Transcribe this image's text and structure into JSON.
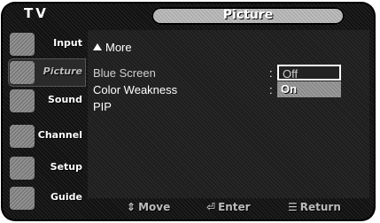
{
  "header": {
    "device_label": "TV",
    "menu_title": "Picture"
  },
  "sidebar": {
    "items": [
      {
        "label": "Input",
        "icon": "input-icon"
      },
      {
        "label": "Picture",
        "icon": "picture-icon",
        "active": true
      },
      {
        "label": "Sound",
        "icon": "sound-icon"
      },
      {
        "label": "Channel",
        "icon": "channel-icon"
      },
      {
        "label": "Setup",
        "icon": "setup-icon"
      },
      {
        "label": "Guide",
        "icon": "guide-icon"
      }
    ]
  },
  "main": {
    "more_label": "More",
    "rows": [
      {
        "label": "Blue Screen",
        "separator": ":"
      },
      {
        "label": "Color Weakness",
        "separator": ":"
      },
      {
        "label": "PIP"
      }
    ],
    "dropdown": {
      "options": [
        "Off",
        "On"
      ],
      "highlighted": "On",
      "current": "Off"
    }
  },
  "footer": {
    "hints": [
      {
        "icon": "move-arrows-icon",
        "label": "Move"
      },
      {
        "icon": "enter-icon",
        "label": "Enter"
      },
      {
        "icon": "return-icon",
        "label": "Return"
      }
    ]
  },
  "colors": {
    "background": "#1e1e1e",
    "highlight": "#9a9a9a",
    "text": "#ffffff"
  }
}
